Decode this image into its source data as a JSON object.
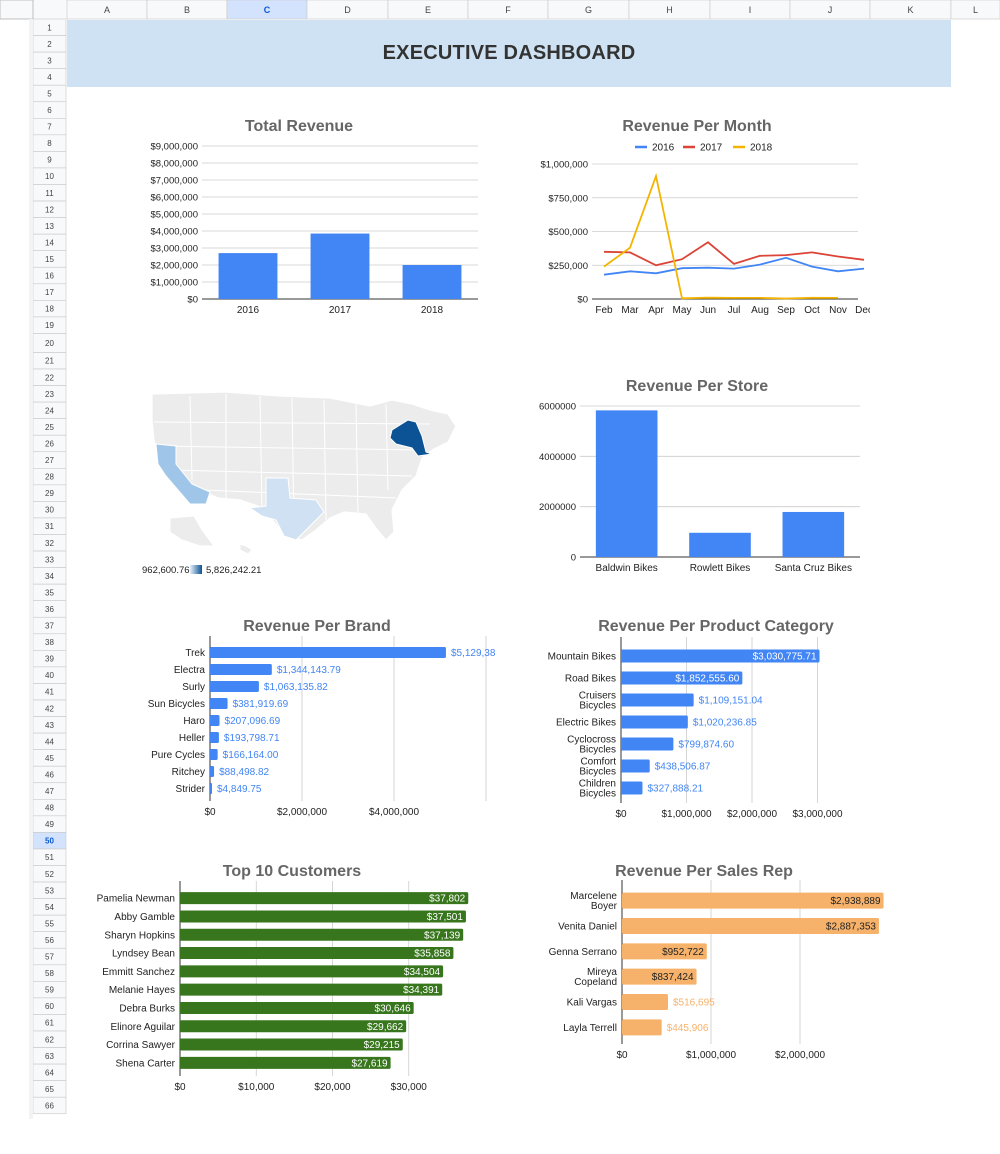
{
  "sheet": {
    "columns": [
      "A",
      "B",
      "C",
      "D",
      "E",
      "F",
      "G",
      "H",
      "I",
      "J",
      "K",
      "L"
    ],
    "selected_column": "C",
    "rows_count": 66,
    "selected_row": 50,
    "title": "EXECUTIVE DASHBOARD",
    "banner_color": "#cfe2f3"
  },
  "map": {
    "legend_min": "962,600.76",
    "legend_max": "5,826,242.21",
    "colors": {
      "low": "#d0e1f3",
      "mid": "#9fc5e8",
      "high": "#0b5394"
    },
    "highlighted_states": [
      "New York",
      "California",
      "Texas"
    ]
  },
  "chart_data": [
    {
      "id": "total_revenue",
      "type": "bar",
      "title": "Total Revenue",
      "categories": [
        "2016",
        "2017",
        "2018"
      ],
      "values": [
        2700000,
        3850000,
        2000000
      ],
      "ylim": [
        0,
        9000000
      ],
      "yticks": [
        0,
        1000000,
        2000000,
        3000000,
        4000000,
        5000000,
        6000000,
        7000000,
        8000000,
        9000000
      ],
      "ytick_labels": [
        "$0",
        "$1,000,000",
        "$2,000,000",
        "$3,000,000",
        "$4,000,000",
        "$5,000,000",
        "$6,000,000",
        "$7,000,000",
        "$8,000,000",
        "$9,000,000"
      ],
      "color": "#4285f4"
    },
    {
      "id": "revenue_per_month",
      "type": "line",
      "title": "Revenue Per Month",
      "categories": [
        "Feb",
        "Mar",
        "Apr",
        "May",
        "Jun",
        "Jul",
        "Aug",
        "Sep",
        "Oct",
        "Nov",
        "Dec"
      ],
      "ylim": [
        0,
        1000000
      ],
      "yticks": [
        0,
        250000,
        500000,
        750000,
        1000000
      ],
      "ytick_labels": [
        "$0",
        "$250,000",
        "$500,000",
        "$750,000",
        "$1,000,000"
      ],
      "series": [
        {
          "name": "2016",
          "color": "#4285f4",
          "values": [
            180000,
            205000,
            190000,
            228000,
            232000,
            225000,
            255000,
            305000,
            240000,
            205000,
            225000
          ]
        },
        {
          "name": "2017",
          "color": "#db4437",
          "values": [
            350000,
            345000,
            250000,
            295000,
            420000,
            260000,
            320000,
            325000,
            345000,
            315000,
            290000
          ]
        },
        {
          "name": "2018",
          "color": "#f4b400",
          "values": [
            240000,
            380000,
            910000,
            5000,
            10000,
            8000,
            8000,
            4000,
            9000,
            8000,
            null
          ]
        }
      ],
      "legend": "top"
    },
    {
      "id": "revenue_per_store",
      "type": "bar",
      "title": "Revenue Per Store",
      "categories": [
        "Baldwin Bikes",
        "Rowlett Bikes",
        "Santa Cruz Bikes"
      ],
      "values": [
        5826242.21,
        962600.76,
        1790000
      ],
      "ylim": [
        0,
        6000000
      ],
      "yticks": [
        0,
        2000000,
        4000000,
        6000000
      ],
      "ytick_labels": [
        "0",
        "2000000",
        "4000000",
        "6000000"
      ],
      "color": "#4285f4"
    },
    {
      "id": "revenue_per_brand",
      "type": "bar",
      "orientation": "horizontal",
      "title": "Revenue Per Brand",
      "categories": [
        "Trek",
        "Electra",
        "Surly",
        "Sun Bicycles",
        "Haro",
        "Heller",
        "Pure Cycles",
        "Ritchey",
        "Strider"
      ],
      "values": [
        5129380,
        1344143.79,
        1063135.82,
        381919.69,
        207096.69,
        193798.71,
        166164.0,
        88498.82,
        4849.75
      ],
      "data_labels": [
        "$5,129,38",
        "$1,344,143.79",
        "$1,063,135.82",
        "$381,919.69",
        "$207,096.69",
        "$193,798.71",
        "$166,164.00",
        "$88,498.82",
        "$4,849.75"
      ],
      "xlim": [
        0,
        6000000
      ],
      "xticks": [
        0,
        2000000,
        4000000
      ],
      "xtick_labels": [
        "$0",
        "$2,000,000",
        "$4,000,000"
      ],
      "color": "#4285f4",
      "label_color": "#4285f4"
    },
    {
      "id": "revenue_per_category",
      "type": "bar",
      "orientation": "horizontal",
      "title": "Revenue Per Product Category",
      "categories": [
        [
          "Mountain Bikes"
        ],
        [
          "Road Bikes"
        ],
        [
          "Cruisers",
          "Bicycles"
        ],
        [
          "Electric Bikes"
        ],
        [
          "Cyclocross",
          "Bicycles"
        ],
        [
          "Comfort",
          "Bicycles"
        ],
        [
          "Children",
          "Bicycles"
        ]
      ],
      "values": [
        3030775.71,
        1852555.6,
        1109151.04,
        1020236.85,
        799874.6,
        438506.87,
        327888.21
      ],
      "data_labels": [
        "$3,030,775.71",
        "$1,852,555.60",
        "$1,109,151.04",
        "$1,020,236.85",
        "$799,874.60",
        "$438,506.87",
        "$327,888.21"
      ],
      "xlim": [
        0,
        4000000
      ],
      "xticks": [
        0,
        1000000,
        2000000,
        3000000
      ],
      "xtick_labels": [
        "$0",
        "$1,000,000",
        "$2,000,000",
        "$3,000,000"
      ],
      "color": "#4285f4",
      "label_color": "#4285f4"
    },
    {
      "id": "top_customers",
      "type": "bar",
      "orientation": "horizontal",
      "title": "Top 10 Customers",
      "categories": [
        "Pamelia Newman",
        "Abby Gamble",
        "Sharyn Hopkins",
        "Lyndsey Bean",
        "Emmitt Sanchez",
        "Melanie Hayes",
        "Debra Burks",
        "Elinore Aguilar",
        "Corrina Sawyer",
        "Shena Carter"
      ],
      "values": [
        37802,
        37501,
        37139,
        35858,
        34504,
        34391,
        30646,
        29662,
        29215,
        27619
      ],
      "data_labels": [
        "$37,802",
        "$37,501",
        "$37,139",
        "$35,858",
        "$34,504",
        "$34,391",
        "$30,646",
        "$29,662",
        "$29,215",
        "$27,619"
      ],
      "xlim": [
        0,
        40000
      ],
      "xticks": [
        0,
        10000,
        20000,
        30000
      ],
      "xtick_labels": [
        "$0",
        "$10,000",
        "$20,000",
        "$30,000"
      ],
      "color": "#38761d",
      "label_color": "#38761d"
    },
    {
      "id": "revenue_per_sales_rep",
      "type": "bar",
      "orientation": "horizontal",
      "title": "Revenue Per Sales Rep",
      "categories": [
        [
          "Marcelene",
          "Boyer"
        ],
        [
          "Venita Daniel"
        ],
        [
          "Genna Serrano"
        ],
        [
          "Mireya",
          "Copeland"
        ],
        [
          "Kali Vargas"
        ],
        [
          "Layla Terrell"
        ]
      ],
      "values": [
        2938889,
        2887353,
        952722,
        837424,
        516695,
        445906
      ],
      "data_labels": [
        "$2,938,889",
        "$2,887,353",
        "$952,722",
        "$837,424",
        "$516,695",
        "$445,906"
      ],
      "xlim": [
        0,
        3000000
      ],
      "xticks": [
        0,
        1000000,
        2000000
      ],
      "xtick_labels": [
        "$0",
        "$1,000,000",
        "$2,000,000"
      ],
      "color": "#f6b26b",
      "label_color": "#f6b26b"
    }
  ]
}
